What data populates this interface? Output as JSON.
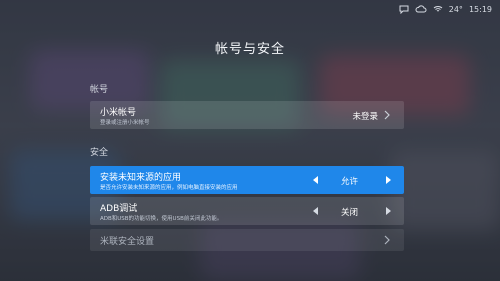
{
  "status": {
    "temperature": "24°",
    "time": "15:19",
    "icons": [
      "message-icon",
      "cloud-icon",
      "wifi-icon"
    ]
  },
  "page": {
    "title": "帐号与安全"
  },
  "sections": {
    "account": {
      "label": "帐号",
      "items": [
        {
          "title": "小米帐号",
          "subtitle": "登录或注册小米帐号",
          "value": "未登录"
        }
      ]
    },
    "security": {
      "label": "安全",
      "items": [
        {
          "title": "安装未知来源的应用",
          "subtitle": "是否允许安装未知来源的应用，例如电脑直接安装的应用",
          "value": "允许",
          "selected": true
        },
        {
          "title": "ADB调试",
          "subtitle": "ADB和USB的功能切换，使用USB前关闭此功能。",
          "value": "关闭"
        },
        {
          "title": "米联安全设置",
          "subtitle": ""
        }
      ]
    }
  },
  "colors": {
    "accent": "#1f87ea",
    "row_bg": "rgba(255,255,255,0.12)"
  }
}
